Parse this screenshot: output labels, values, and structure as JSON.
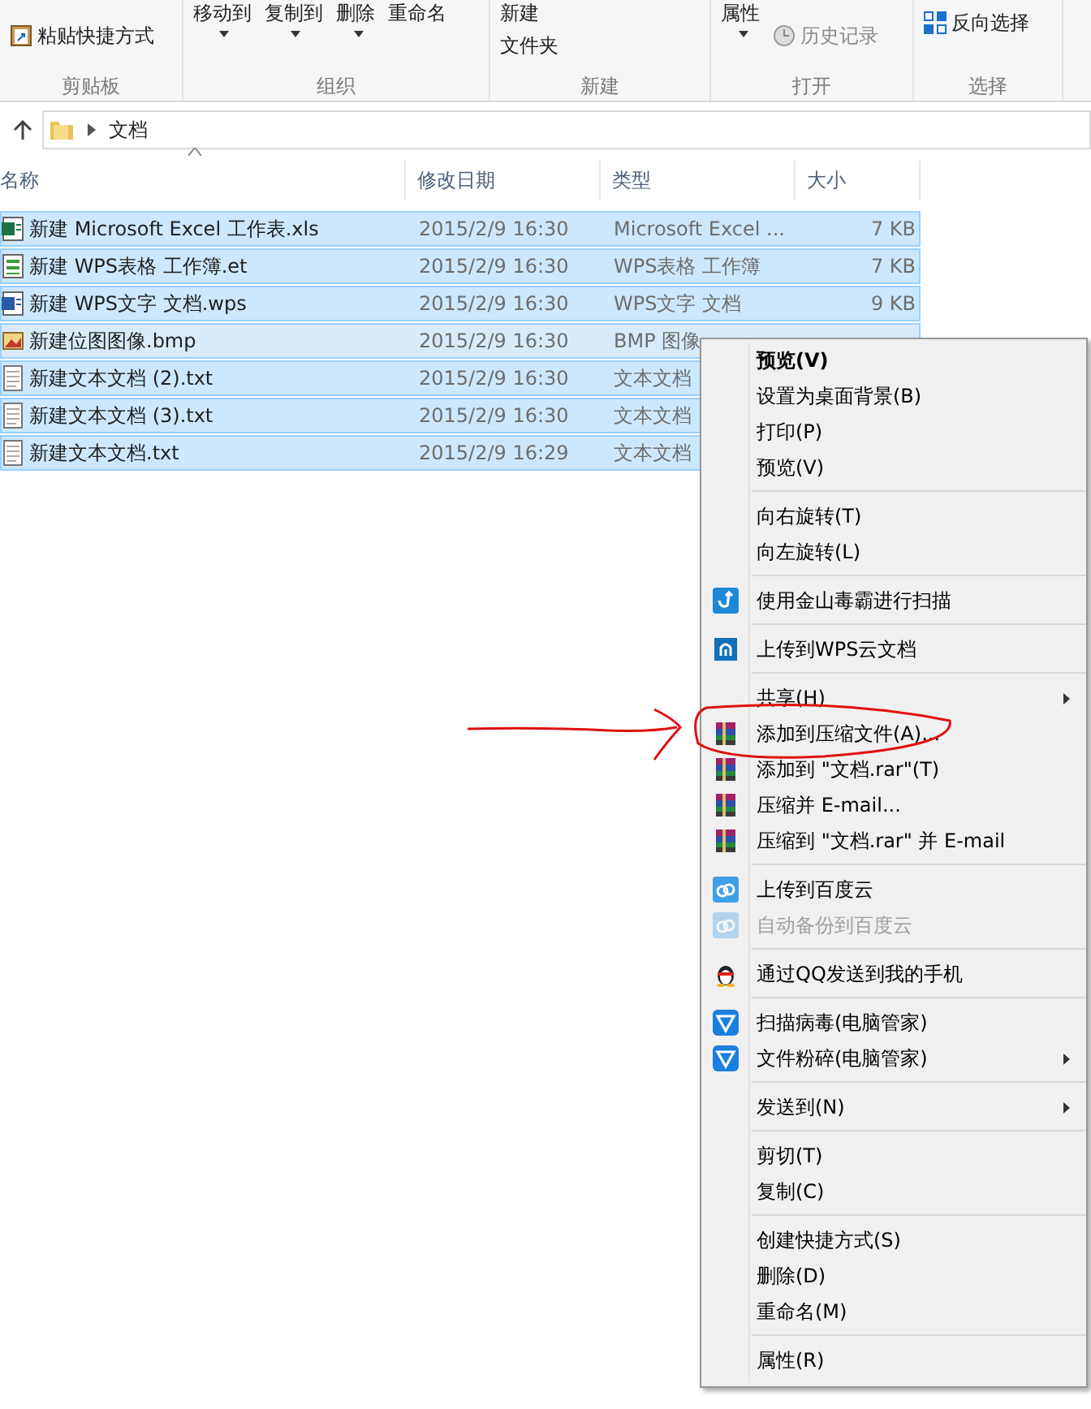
{
  "ribbon": {
    "groups": [
      {
        "label": "剪贴板",
        "buttons": [
          {
            "label": "粘贴快捷方式",
            "kind": "shortcut",
            "caret": false,
            "disabled": false
          }
        ]
      },
      {
        "label": "组织",
        "buttons": [
          {
            "label": "移动到",
            "kind": "text",
            "caret": true,
            "disabled": false
          },
          {
            "label": "复制到",
            "kind": "text",
            "caret": true,
            "disabled": false
          },
          {
            "label": "删除",
            "kind": "text",
            "caret": true,
            "disabled": false
          },
          {
            "label": "重命名",
            "kind": "text",
            "caret": false,
            "disabled": false
          }
        ]
      },
      {
        "label": "新建",
        "buttons": [
          {
            "label": "新建",
            "kind": "text",
            "caret": false,
            "disabled": false
          },
          {
            "label": "文件夹",
            "kind": "text",
            "caret": false,
            "disabled": false
          }
        ]
      },
      {
        "label": "打开",
        "buttons": [
          {
            "label": "属性",
            "kind": "text",
            "caret": true,
            "disabled": false
          },
          {
            "label": "历史记录",
            "kind": "history",
            "caret": false,
            "disabled": true
          }
        ]
      },
      {
        "label": "选择",
        "buttons": [
          {
            "label": "反向选择",
            "kind": "invert",
            "caret": false,
            "disabled": false
          }
        ]
      }
    ]
  },
  "address": {
    "path": "文档"
  },
  "table": {
    "columns": [
      "名称",
      "修改日期",
      "类型",
      "大小"
    ],
    "rows": [
      {
        "kind": "excel",
        "name": "新建 Microsoft Excel 工作表.xls",
        "date": "2015/2/9 16:30",
        "type": "Microsoft Excel ...",
        "size": "7 KB",
        "selected": true,
        "focused": false
      },
      {
        "kind": "sheet",
        "name": "新建 WPS表格 工作簿.et",
        "date": "2015/2/9 16:30",
        "type": "WPS表格 工作簿",
        "size": "7 KB",
        "selected": true,
        "focused": false
      },
      {
        "kind": "doc",
        "name": "新建 WPS文字 文档.wps",
        "date": "2015/2/9 16:30",
        "type": "WPS文字 文档",
        "size": "9 KB",
        "selected": true,
        "focused": false
      },
      {
        "kind": "image",
        "name": "新建位图图像.bmp",
        "date": "2015/2/9 16:30",
        "type": "BMP 图像",
        "selected": true,
        "focused": true
      },
      {
        "kind": "text",
        "name": "新建文本文档 (2).txt",
        "date": "2015/2/9 16:30",
        "type": "文本文档",
        "selected": true,
        "focused": false
      },
      {
        "kind": "text",
        "name": "新建文本文档 (3).txt",
        "date": "2015/2/9 16:30",
        "type": "文本文档",
        "selected": true,
        "focused": false
      },
      {
        "kind": "text",
        "name": "新建文本文档.txt",
        "date": "2015/2/9 16:29",
        "type": "文本文档",
        "selected": true,
        "focused": false
      }
    ]
  },
  "context_menu": {
    "sections": [
      [
        {
          "label": "预览(V)",
          "kind": "plain",
          "default": true,
          "disabled": false,
          "submenu": false
        },
        {
          "label": "设置为桌面背景(B)",
          "kind": "plain",
          "default": false,
          "disabled": false,
          "submenu": false
        },
        {
          "label": "打印(P)",
          "kind": "plain",
          "default": false,
          "disabled": false,
          "submenu": false
        },
        {
          "label": "预览(V)",
          "kind": "plain",
          "default": false,
          "disabled": false,
          "submenu": false
        }
      ],
      [
        {
          "label": "向右旋转(T)",
          "kind": "plain",
          "default": false,
          "disabled": false,
          "submenu": false
        },
        {
          "label": "向左旋转(L)",
          "kind": "plain",
          "default": false,
          "disabled": false,
          "submenu": false
        }
      ],
      [
        {
          "label": "使用金山毒霸进行扫描",
          "kind": "scan",
          "default": false,
          "disabled": false,
          "submenu": false
        }
      ],
      [
        {
          "label": "上传到WPS云文档",
          "kind": "cloud-upload",
          "default": false,
          "disabled": false,
          "submenu": false
        }
      ],
      [
        {
          "label": "共享(H)",
          "kind": "plain",
          "default": false,
          "disabled": false,
          "submenu": true
        },
        {
          "label": "添加到压缩文件(A)...",
          "kind": "archive",
          "default": false,
          "disabled": false,
          "submenu": false
        },
        {
          "label": "添加到 \"文档.rar\"(T)",
          "kind": "archive",
          "default": false,
          "disabled": false,
          "submenu": false
        },
        {
          "label": "压缩并 E-mail...",
          "kind": "archive",
          "default": false,
          "disabled": false,
          "submenu": false
        },
        {
          "label": "压缩到 \"文档.rar\" 并 E-mail",
          "kind": "archive",
          "default": false,
          "disabled": false,
          "submenu": false
        }
      ],
      [
        {
          "label": "上传到百度云",
          "kind": "baidu",
          "default": false,
          "disabled": false,
          "submenu": false
        },
        {
          "label": "自动备份到百度云",
          "kind": "baidu",
          "default": false,
          "disabled": true,
          "submenu": false
        }
      ],
      [
        {
          "label": "通过QQ发送到我的手机",
          "kind": "penguin",
          "default": false,
          "disabled": false,
          "submenu": false
        }
      ],
      [
        {
          "label": "扫描病毒(电脑管家)",
          "kind": "shield",
          "default": false,
          "disabled": false,
          "submenu": false
        },
        {
          "label": "文件粉碎(电脑管家)",
          "kind": "shield",
          "default": false,
          "disabled": false,
          "submenu": true
        }
      ],
      [
        {
          "label": "发送到(N)",
          "kind": "plain",
          "default": false,
          "disabled": false,
          "submenu": true
        }
      ],
      [
        {
          "label": "剪切(T)",
          "kind": "plain",
          "default": false,
          "disabled": false,
          "submenu": false
        },
        {
          "label": "复制(C)",
          "kind": "plain",
          "default": false,
          "disabled": false,
          "submenu": false
        }
      ],
      [
        {
          "label": "创建快捷方式(S)",
          "kind": "plain",
          "default": false,
          "disabled": false,
          "submenu": false
        },
        {
          "label": "删除(D)",
          "kind": "plain",
          "default": false,
          "disabled": false,
          "submenu": false
        },
        {
          "label": "重命名(M)",
          "kind": "plain",
          "default": false,
          "disabled": false,
          "submenu": false
        }
      ],
      [
        {
          "label": "属性(R)",
          "kind": "plain",
          "default": false,
          "disabled": false,
          "submenu": false
        }
      ]
    ]
  }
}
